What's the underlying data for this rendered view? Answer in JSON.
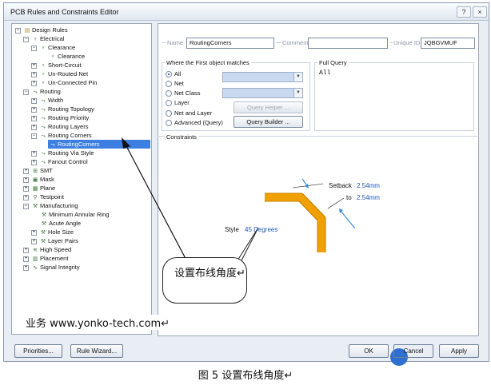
{
  "window": {
    "title": "PCB Rules and Constraints Editor",
    "help_glyph": "?",
    "close_glyph": "×"
  },
  "tree": {
    "items": [
      {
        "label": "Design Rules",
        "exp": "−"
      },
      {
        "label": "Electrical",
        "exp": "−"
      },
      {
        "label": "Clearance",
        "exp": "−"
      },
      {
        "label": "Clearance",
        "exp": ""
      },
      {
        "label": "Short-Circuit",
        "exp": "+"
      },
      {
        "label": "Un-Routed Net",
        "exp": "+"
      },
      {
        "label": "Un-Connected Pin",
        "exp": "+"
      },
      {
        "label": "Routing",
        "exp": "−"
      },
      {
        "label": "Width",
        "exp": "+"
      },
      {
        "label": "Routing Topology",
        "exp": "+"
      },
      {
        "label": "Routing Priority",
        "exp": "+"
      },
      {
        "label": "Routing Layers",
        "exp": "+"
      },
      {
        "label": "Routing Corners",
        "exp": "−"
      },
      {
        "label": "RoutingCorners",
        "exp": ""
      },
      {
        "label": "Routing Via Style",
        "exp": "+"
      },
      {
        "label": "Fanout Control",
        "exp": "+"
      },
      {
        "label": "SMT",
        "exp": "+"
      },
      {
        "label": "Mask",
        "exp": "+"
      },
      {
        "label": "Plane",
        "exp": "+"
      },
      {
        "label": "Testpoint",
        "exp": "+"
      },
      {
        "label": "Manufacturing",
        "exp": "−"
      },
      {
        "label": "Minimum Annular Ring",
        "exp": ""
      },
      {
        "label": "Acute Angle",
        "exp": ""
      },
      {
        "label": "Hole Size",
        "exp": "+"
      },
      {
        "label": "Layer Pairs",
        "exp": "+"
      },
      {
        "label": "High Speed",
        "exp": "+"
      },
      {
        "label": "Placement",
        "exp": "+"
      },
      {
        "label": "Signal Integrity",
        "exp": "+"
      }
    ]
  },
  "rule": {
    "name_label": "Name",
    "name_value": "RoutingCorners",
    "comment_label": "Comment",
    "comment_value": "",
    "uid_label": "Unique ID",
    "uid_value": "JQBGVMUF"
  },
  "match": {
    "title": "Where the First object matches",
    "options": [
      "All",
      "Net",
      "Net Class",
      "Layer",
      "Net and Layer",
      "Advanced (Query)"
    ],
    "selected": "All",
    "query_helper": "Query Helper ...",
    "query_builder": "Query Builder ..."
  },
  "full_query": {
    "title": "Full Query",
    "text": "All"
  },
  "constraints": {
    "title": "Constraints",
    "setback_label": "Setback",
    "setback_value": "2.54mm",
    "to_label": "to",
    "to_value": "2.54mm",
    "style_label": "Style",
    "style_value": "45 Degrees"
  },
  "footer": {
    "priorities": "Priorities...",
    "rule_wizard": "Rule Wizard...",
    "ok": "OK",
    "cancel": "Cancel",
    "apply": "Apply"
  },
  "annotations": {
    "callout": "设置布线角度↵",
    "business": "业务 www.yonko-tech.com↵",
    "caption": "图 5 设置布线角度↵"
  },
  "colors": {
    "trace": "#f0a000",
    "selection": "#3d7fe0",
    "value_blue": "#1f56b6"
  }
}
